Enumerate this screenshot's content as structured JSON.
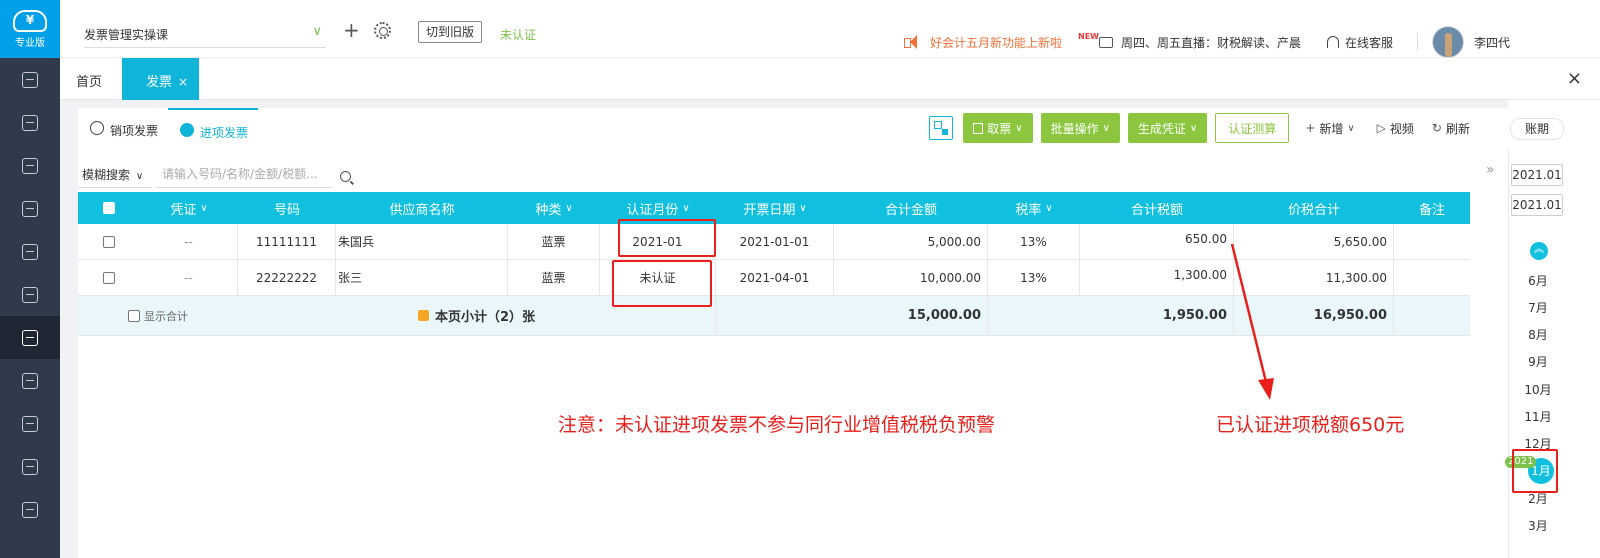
{
  "topbar": {
    "company": "发票管理实操课",
    "switch_old": "切到旧版",
    "cert_status": "未认证",
    "notice": "好会计五月新功能上新啦",
    "new_badge": "NEW",
    "live": "周四、周五直播：财税解读、产晨",
    "service": "在线客服",
    "username": "李四代"
  },
  "logo": {
    "text": "专业版"
  },
  "sidebar": {
    "items": [
      {
        "icon": "home-icon"
      },
      {
        "icon": "voucher-icon"
      },
      {
        "icon": "report-icon"
      },
      {
        "icon": "money-bag-icon"
      },
      {
        "icon": "ledger-icon"
      },
      {
        "icon": "chart-doc-icon"
      },
      {
        "icon": "invoice-icon",
        "active": true
      },
      {
        "icon": "asset-icon"
      },
      {
        "icon": "salary-icon"
      },
      {
        "icon": "tax-icon"
      },
      {
        "icon": "archive-icon"
      }
    ]
  },
  "tabs": {
    "home": "首页",
    "invoice": "发票",
    "close": "×",
    "window_close": "×"
  },
  "subtabs": {
    "sales": "销项发票",
    "purchase": "进项发票"
  },
  "toolbar": {
    "fetch": "取票",
    "batch": "批量操作",
    "voucher": "生成凭证",
    "cert_calc": "认证测算",
    "add": "新增",
    "video": "视频",
    "refresh": "刷新",
    "ledger": "账期"
  },
  "search": {
    "type": "模糊搜索",
    "placeholder": "请输入号码/名称/金额/税额..."
  },
  "table": {
    "headers": [
      "凭证",
      "号码",
      "供应商名称",
      "种类",
      "认证月份",
      "开票日期",
      "合计金额",
      "税率",
      "合计税额",
      "价税合计",
      "备注"
    ],
    "rows": [
      {
        "voucher": "--",
        "number": "11111111",
        "supplier": "朱国兵",
        "kind": "蓝票",
        "cert_month": "2021-01",
        "date": "2021-01-01",
        "amount": "5,000.00",
        "rate": "13%",
        "tax": "650.00",
        "total": "5,650.00",
        "remark": ""
      },
      {
        "voucher": "--",
        "number": "22222222",
        "supplier": "张三",
        "kind": "蓝票",
        "cert_month": "未认证",
        "date": "2021-04-01",
        "amount": "10,000.00",
        "rate": "13%",
        "tax": "1,300.00",
        "total": "11,300.00",
        "remark": ""
      }
    ],
    "footer": {
      "show_total": "显示合计",
      "subtotal": "本页小计（2）张",
      "amount": "15,000.00",
      "tax": "1,950.00",
      "total": "16,950.00"
    }
  },
  "annotations": {
    "main": "注意：未认证进项发票不参与同行业增值税税负预警",
    "right": "已认证进项税额650元"
  },
  "month_panel": {
    "start": "2021.01",
    "end": "2021.01",
    "months": [
      "6月",
      "7月",
      "8月",
      "9月",
      "10月",
      "11月",
      "12月",
      "1月",
      "2月",
      "3月"
    ],
    "active_month": "1月",
    "year_tag": "2021"
  },
  "colors": {
    "accent": "#10c0de",
    "green": "#8cc63f",
    "sidebar": "#2f3a4a",
    "annotation_red": "#e8201c",
    "notice_orange": "#f0713a"
  }
}
